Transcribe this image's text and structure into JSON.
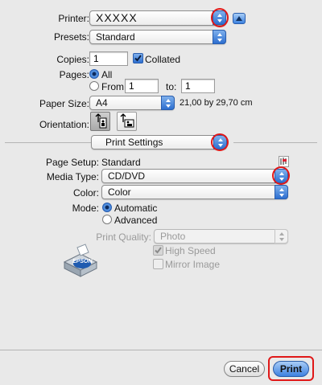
{
  "printer": {
    "label": "Printer:",
    "value": "XXXXX"
  },
  "presets": {
    "label": "Presets:",
    "value": "Standard"
  },
  "copies": {
    "label": "Copies:",
    "value": "1",
    "collated_label": "Collated",
    "collated": true
  },
  "pages": {
    "label": "Pages:",
    "all_label": "All",
    "from_label": "From:",
    "from_value": "1",
    "to_label": "to:",
    "to_value": "1"
  },
  "paper_size": {
    "label": "Paper Size:",
    "value": "A4",
    "dimensions": "21,00 by 29,70 cm"
  },
  "orientation": {
    "label": "Orientation:"
  },
  "section": {
    "value": "Print Settings"
  },
  "page_setup": {
    "label": "Page Setup:",
    "value": "Standard"
  },
  "media_type": {
    "label": "Media Type:",
    "value": "CD/DVD"
  },
  "color": {
    "label": "Color:",
    "value": "Color"
  },
  "mode": {
    "label": "Mode:",
    "automatic": "Automatic",
    "advanced": "Advanced"
  },
  "print_quality": {
    "label": "Print Quality:",
    "value": "Photo"
  },
  "high_speed": {
    "label": "High Speed"
  },
  "mirror_image": {
    "label": "Mirror Image"
  },
  "logo": {
    "text": "EPSON"
  },
  "buttons": {
    "cancel": "Cancel",
    "print": "Print"
  },
  "colors": {
    "accent": "#2d6fd0",
    "highlight_ring": "#e01818"
  }
}
